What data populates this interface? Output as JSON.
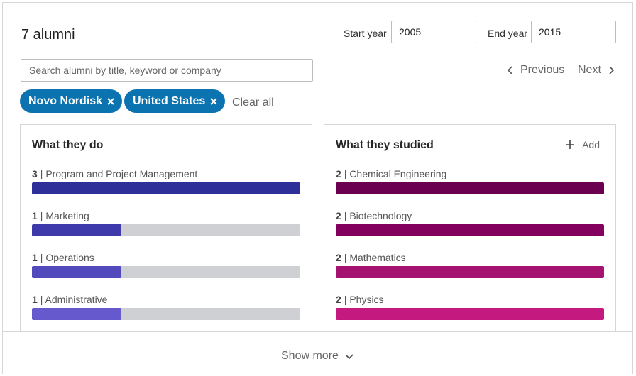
{
  "header": {
    "count_label": "7 alumni",
    "start_year_label": "Start year",
    "start_year_value": "2005",
    "end_year_label": "End year",
    "end_year_value": "2015"
  },
  "search": {
    "placeholder": "Search alumni by title, keyword or company"
  },
  "pager": {
    "previous_label": "Previous",
    "next_label": "Next"
  },
  "filters": {
    "chips": [
      {
        "label": "Novo Nordisk"
      },
      {
        "label": "United States"
      }
    ],
    "clear_label": "Clear all"
  },
  "what_they_do": {
    "title": "What they do",
    "items": [
      {
        "count": "3",
        "label": "| Program and Project Management",
        "fraction": 1.0,
        "color": "#2f2f9a"
      },
      {
        "count": "1",
        "label": "| Marketing",
        "fraction": 0.333,
        "color": "#3f3aab"
      },
      {
        "count": "1",
        "label": "| Operations",
        "fraction": 0.333,
        "color": "#5249bd"
      },
      {
        "count": "1",
        "label": "| Administrative",
        "fraction": 0.333,
        "color": "#6659cd"
      }
    ]
  },
  "what_they_studied": {
    "title": "What they studied",
    "add_label": "Add",
    "items": [
      {
        "count": "2",
        "label": "| Chemical Engineering",
        "fraction": 1.0,
        "color": "#6c0050"
      },
      {
        "count": "2",
        "label": "| Biotechnology",
        "fraction": 1.0,
        "color": "#83005f"
      },
      {
        "count": "2",
        "label": "| Mathematics",
        "fraction": 1.0,
        "color": "#a3136f"
      },
      {
        "count": "2",
        "label": "| Physics",
        "fraction": 1.0,
        "color": "#c41a7f"
      }
    ]
  },
  "footer": {
    "show_more_label": "Show more"
  },
  "icons": {
    "prev": "chevron-left-icon",
    "next": "chevron-right-icon",
    "remove": "close-icon",
    "add": "plus-icon",
    "expand": "chevron-down-icon"
  }
}
